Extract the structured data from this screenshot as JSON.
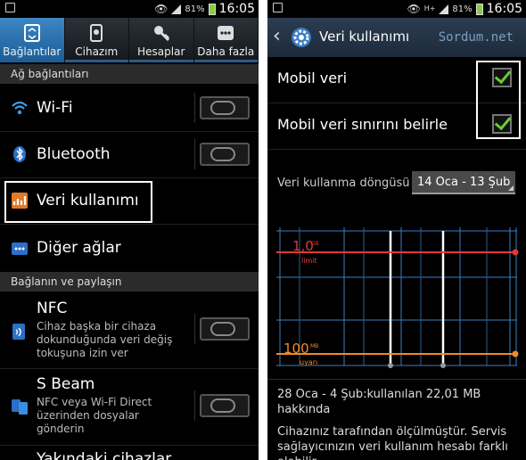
{
  "left": {
    "status": {
      "battery": "81%",
      "time": "16:05"
    },
    "tabs": [
      {
        "label": "Bağlantılar",
        "icon": "connections-icon",
        "active": true
      },
      {
        "label": "Cihazım",
        "icon": "device-icon",
        "active": false
      },
      {
        "label": "Hesaplar",
        "icon": "key-icon",
        "active": false
      },
      {
        "label": "Daha fazla",
        "icon": "more-icon",
        "active": false
      }
    ],
    "sections": {
      "network": "Ağ bağlantıları",
      "connect_share": "Bağlanın ve paylaşın"
    },
    "rows": {
      "wifi": "Wi-Fi",
      "bluetooth": "Bluetooth",
      "data_usage": "Veri kullanımı",
      "other_networks": "Diğer ağlar",
      "nfc_title": "NFC",
      "nfc_desc": "Cihaz başka bir cihaza dokunduğunda veri değiş tokuşuna izin ver",
      "sbeam_title": "S Beam",
      "sbeam_desc": "NFC veya Wi-Fi Direct üzerinden dosyalar gönderin",
      "nearby": "Yakındaki cihazlar"
    },
    "toggles": {
      "wifi": false,
      "bluetooth": false,
      "nfc": false,
      "sbeam": false
    }
  },
  "right": {
    "status": {
      "battery": "81%",
      "time": "16:05",
      "network": "H+"
    },
    "title": "Veri kullanımı",
    "watermark": "Sordum.net",
    "mobile_data": {
      "label": "Mobil veri",
      "checked": true
    },
    "set_limit": {
      "label": "Mobil veri sınırını belirle",
      "checked": true
    },
    "cycle": {
      "label": "Veri kullanma döngüsü",
      "value": "14 Oca - 13 Şub"
    },
    "graph": {
      "limit_value": "1,0",
      "limit_unit": "GB",
      "limit_label": "limit",
      "warn_value": "100",
      "warn_unit": "MB",
      "warn_label": "uyarı",
      "limit_color": "#e03a3a",
      "warn_color": "#f08a24",
      "grid_color": "#3a7fc0"
    },
    "summary": "28 Oca - 4 Şub:kullanılan 22,01 MB hakkında",
    "measured": "Cihazınız tarafından ölçülmüştür. Servis sağlayıcınızın veri kullanım hesabı farklı olabilir."
  }
}
